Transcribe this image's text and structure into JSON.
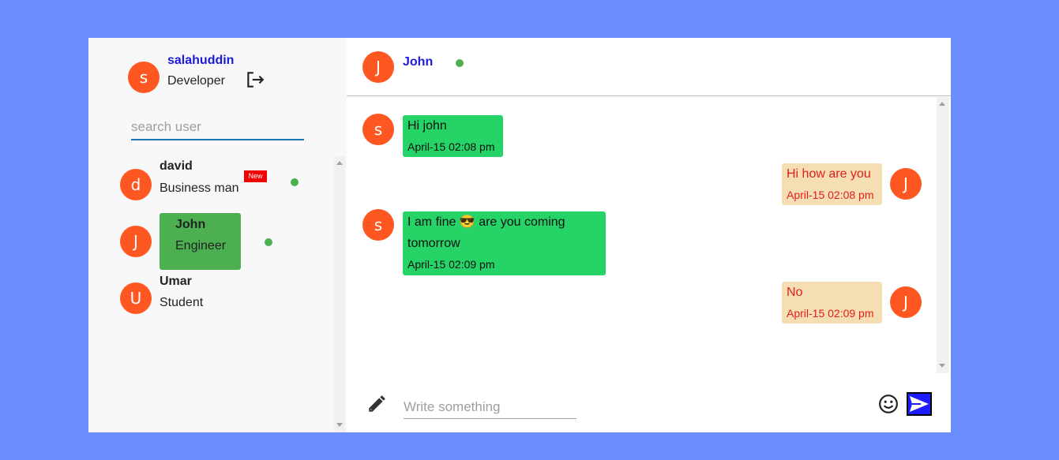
{
  "me": {
    "initial": "s",
    "name": "salahuddin",
    "role": "Developer"
  },
  "search": {
    "placeholder": "search user"
  },
  "users": [
    {
      "initial": "d",
      "name": "david",
      "role": "Business man",
      "badge": "New",
      "online": true
    },
    {
      "initial": "J",
      "name": "John",
      "role": "Engineer",
      "selected": true,
      "online": true
    },
    {
      "initial": "U",
      "name": "Umar",
      "role": "Student",
      "online": false
    }
  ],
  "chat": {
    "contact_initial": "J",
    "contact_name": "John",
    "online": true,
    "messages": [
      {
        "from": "s",
        "direction": "in",
        "text": "Hi john",
        "time": "April-15 02:08 pm"
      },
      {
        "from": "J",
        "direction": "out",
        "text": "Hi how are you",
        "time": "April-15 02:08 pm"
      },
      {
        "from": "s",
        "direction": "in",
        "text_before": "I am fine",
        "emoji": "😎",
        "text_after": "are you coming",
        "text_line2": "tomorrow",
        "time": "April-15 02:09 pm"
      },
      {
        "from": "J",
        "direction": "out",
        "text": "No",
        "time": "April-15 02:09 pm"
      }
    ],
    "input_placeholder": "Write something"
  },
  "colors": {
    "background": "#6b8cfb",
    "avatar": "#ff5722",
    "online": "#4caf50",
    "incoming": "#26d367",
    "outgoing": "#f5deb3",
    "outgoing_text": "#e0201a",
    "name_link": "#1a1ad6",
    "send": "#1c1cff"
  }
}
